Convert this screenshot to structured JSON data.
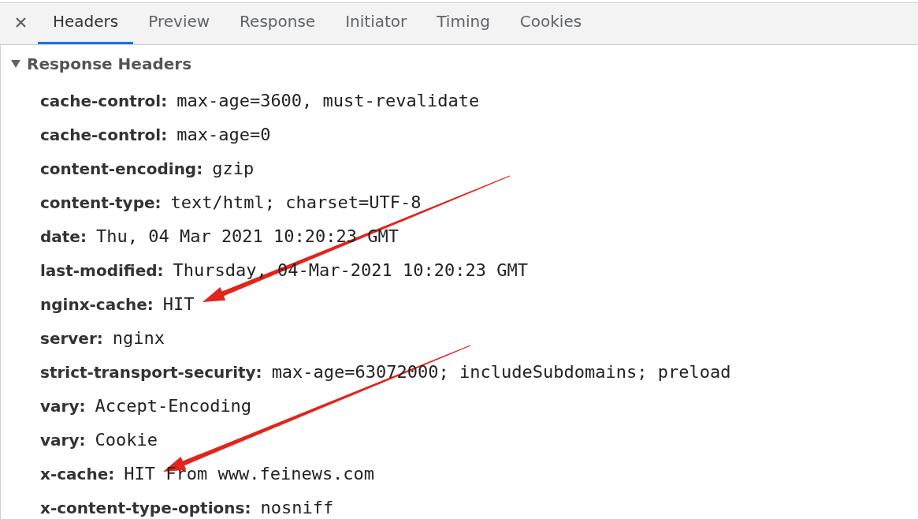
{
  "tabs": [
    {
      "label": "Headers",
      "selected": true
    },
    {
      "label": "Preview",
      "selected": false
    },
    {
      "label": "Response",
      "selected": false
    },
    {
      "label": "Initiator",
      "selected": false
    },
    {
      "label": "Timing",
      "selected": false
    },
    {
      "label": "Cookies",
      "selected": false
    }
  ],
  "section": {
    "title": "Response Headers",
    "expanded": true
  },
  "headers": [
    {
      "name": "cache-control:",
      "value": "max-age=3600, must-revalidate",
      "arrow": false
    },
    {
      "name": "cache-control:",
      "value": "max-age=0",
      "arrow": false
    },
    {
      "name": "content-encoding:",
      "value": "gzip",
      "arrow": false
    },
    {
      "name": "content-type:",
      "value": "text/html; charset=UTF-8",
      "arrow": false
    },
    {
      "name": "date:",
      "value": "Thu, 04 Mar 2021 10:20:23 GMT",
      "arrow": false
    },
    {
      "name": "last-modified:",
      "value": "Thursday, 04-Mar-2021 10:20:23 GMT",
      "arrow": false
    },
    {
      "name": "nginx-cache:",
      "value": "HIT",
      "arrow": true
    },
    {
      "name": "server:",
      "value": "nginx",
      "arrow": false
    },
    {
      "name": "strict-transport-security:",
      "value": "max-age=63072000; includeSubdomains; preload",
      "arrow": false
    },
    {
      "name": "vary:",
      "value": "Accept-Encoding",
      "arrow": false
    },
    {
      "name": "vary:",
      "value": "Cookie",
      "arrow": false
    },
    {
      "name": "x-cache:",
      "value": "HIT From www.feinews.com",
      "arrow": true
    },
    {
      "name": "x-content-type-options:",
      "value": "nosniff",
      "arrow": false
    }
  ]
}
